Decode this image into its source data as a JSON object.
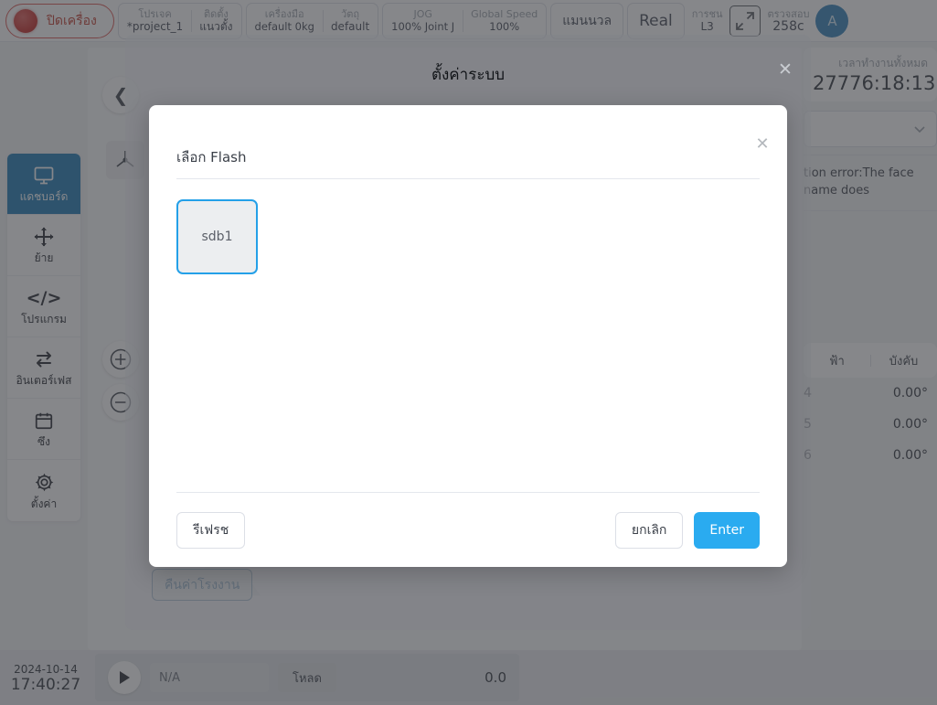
{
  "topbar": {
    "power": {
      "label": "ปิดเครื่อง",
      "icon": "power-dot-icon"
    },
    "tabs": [
      {
        "top": "โปรเจค",
        "bottom": "*project_1"
      },
      {
        "top": "ติดตั้ง",
        "bottom": "แนวตั้ง"
      },
      {
        "top": "เครื่องมือ",
        "bottom": "default  0kg"
      },
      {
        "top": "วัตถุ",
        "bottom": "default"
      },
      {
        "top": "JOG",
        "bottom": "100%  Joint J"
      },
      {
        "top": "Global Speed",
        "bottom": "100%"
      }
    ],
    "manual_label": "แมนนวล",
    "real_label": "Real",
    "collision": {
      "top": "การชน",
      "bottom": "L3"
    },
    "expand_icon": "expand-arrows-icon",
    "check": {
      "top": "ตรวจสอบ",
      "bottom": "258c"
    },
    "avatar_label": "A"
  },
  "sidebar": {
    "items": [
      {
        "label": "แดชบอร์ด",
        "icon": "monitor-icon",
        "active": true
      },
      {
        "label": "ย้าย",
        "icon": "move-icon",
        "active": false
      },
      {
        "label": "โปรแกรม",
        "icon": "code-icon",
        "active": false
      },
      {
        "label": "อินเตอร์เฟส",
        "icon": "exchange-icon",
        "active": false
      },
      {
        "label": "ซึง",
        "icon": "calendar-icon",
        "active": false
      },
      {
        "label": "ตั้งค่า",
        "icon": "gear-icon",
        "active": false
      }
    ]
  },
  "canvas": {
    "collapse_icon": "chevron-left-icon",
    "axis_icon": "axis-origin-icon",
    "zoom_in_icon": "plus-circle-icon",
    "zoom_out_icon": "minus-circle-icon",
    "factory_reset_label": "คืนค่าโรงงาน"
  },
  "right_panel": {
    "runtime_label": "เวลาทำงานทั้งหมด",
    "runtime_value": "27776:18:13",
    "select_icon": "chevron-down-icon",
    "error_text": "tion error:The face name does",
    "table_headers": [
      "ฟ้า",
      "บังคับ"
    ],
    "rows": [
      {
        "name": "4",
        "value": "0.00°"
      },
      {
        "name": "5",
        "value": "0.00°"
      },
      {
        "name": "6",
        "value": "0.00°"
      }
    ]
  },
  "bottombar": {
    "date": "2024-10-14",
    "time": "17:40:27",
    "play_icon": "play-icon",
    "progress_text": "N/A",
    "load_label": "โหลด",
    "progress_value": "0.0"
  },
  "outer_dialog": {
    "title": "ตั้งค่าระบบ",
    "close_icon": "close-icon"
  },
  "inner_dialog": {
    "close_icon": "close-icon",
    "heading": "เลือก Flash",
    "devices": [
      {
        "name": "sdb1",
        "selected": true
      }
    ],
    "refresh_label": "รีเฟรช",
    "cancel_label": "ยกเลิก",
    "enter_label": "Enter"
  },
  "colors": {
    "accent": "#1878b4",
    "primary_button": "#2aabf0",
    "selection_border": "#24a0e8",
    "power_red": "#c0392b",
    "avatar_blue": "#2d7fb8"
  }
}
